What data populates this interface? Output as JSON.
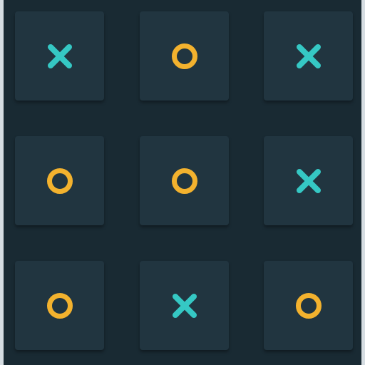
{
  "board": {
    "cells": [
      {
        "mark": "X",
        "icon": "x-mark-icon"
      },
      {
        "mark": "O",
        "icon": "o-mark-icon"
      },
      {
        "mark": "X",
        "icon": "x-mark-icon"
      },
      {
        "mark": "O",
        "icon": "o-mark-icon"
      },
      {
        "mark": "O",
        "icon": "o-mark-icon"
      },
      {
        "mark": "X",
        "icon": "x-mark-icon"
      },
      {
        "mark": "O",
        "icon": "o-mark-icon"
      },
      {
        "mark": "X",
        "icon": "x-mark-icon"
      },
      {
        "mark": "O",
        "icon": "o-mark-icon"
      }
    ]
  },
  "colors": {
    "background": "#192a33",
    "cell": "#213540",
    "x_mark": "#35c8c4",
    "o_mark": "#f3b22e"
  }
}
